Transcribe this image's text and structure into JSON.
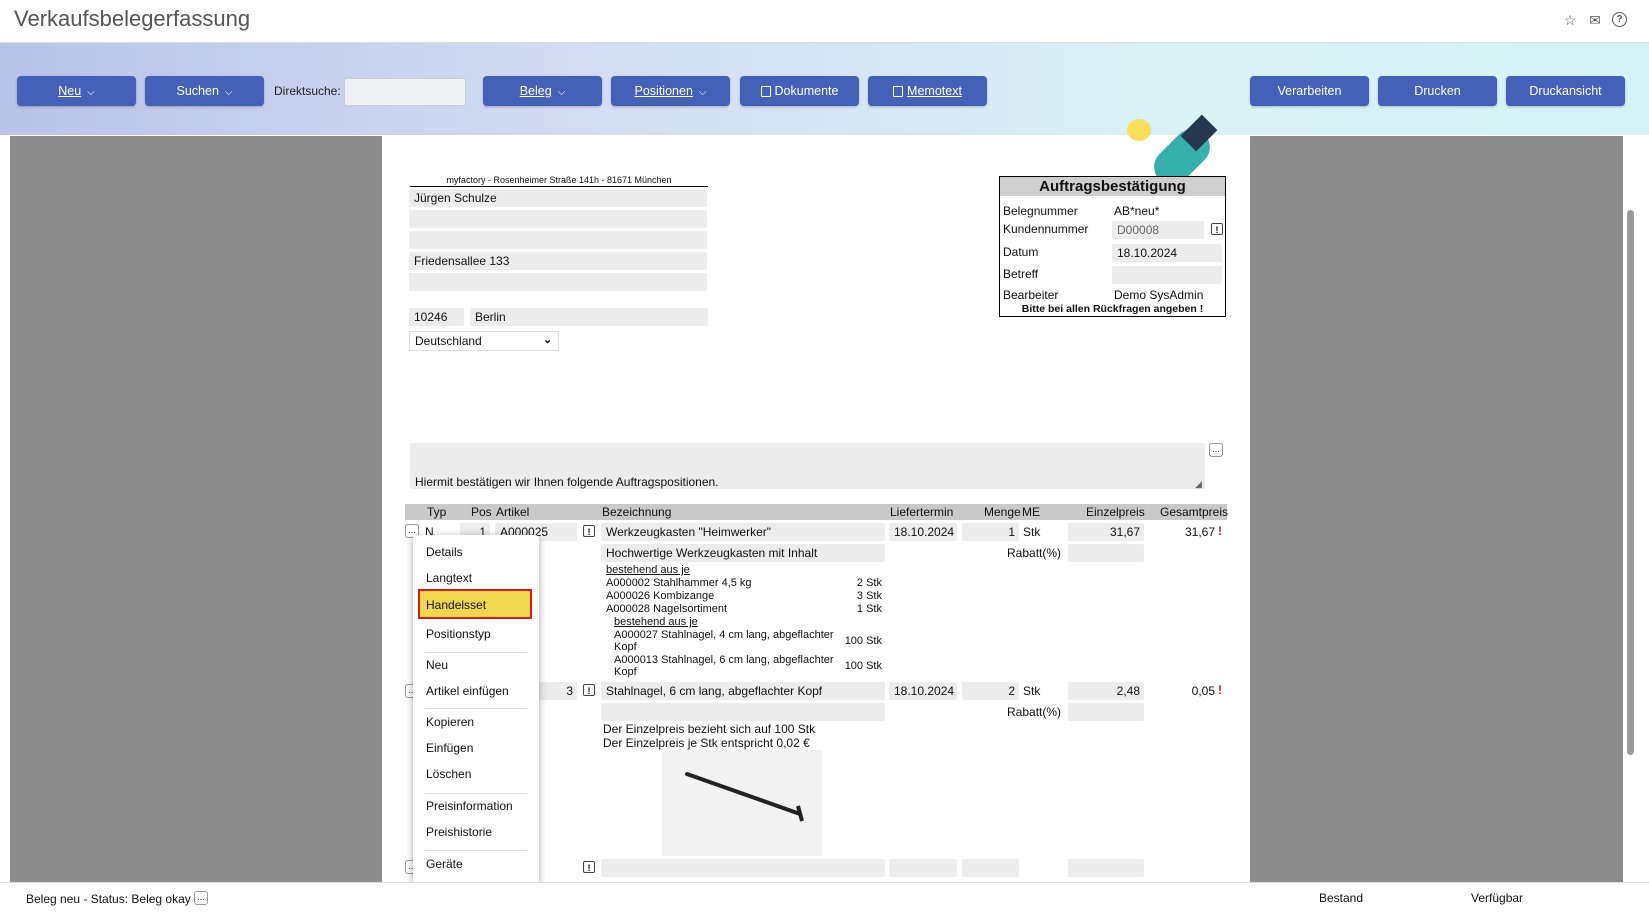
{
  "window": {
    "title": "Verkaufsbelegerfassung"
  },
  "icons": {
    "star": "star-icon",
    "mail": "mail-icon",
    "help": "help-icon"
  },
  "toolbar": {
    "neu": "Neu",
    "suchen": "Suchen",
    "direkt_label": "Direktsuche:",
    "direkt_value": "",
    "beleg": "Beleg",
    "positionen": "Positionen",
    "dokumente": "Dokumente",
    "memotext": "Memotext",
    "verarbeiten": "Verarbeiten",
    "drucken": "Drucken",
    "druckansicht": "Druckansicht"
  },
  "colors": {
    "button": "#4560b7",
    "highlight": "#f0d84e",
    "highlight_border": "#e01818"
  },
  "address": {
    "sender": "myfactory - Rosenheimer Straße 141h - 81671 München",
    "name": "Jürgen Schulze",
    "line2": "",
    "line3": "",
    "street": "Friedensallee 133",
    "line5": "",
    "zip": "10246",
    "city": "Berlin",
    "country": "Deutschland"
  },
  "doc": {
    "heading": "Auftragsbestätigung",
    "belegnummer_label": "Belegnummer",
    "belegnummer": "AB*neu*",
    "kundennummer_label": "Kundennummer",
    "kundennummer": "D00008",
    "datum_label": "Datum",
    "datum": "18.10.2024",
    "betreff_label": "Betreff",
    "betreff": "",
    "bearbeiter_label": "Bearbeiter",
    "bearbeiter": "Demo SysAdmin",
    "note": "Bitte bei allen Rückfragen angeben !"
  },
  "intro_text": "Hiermit bestätigen wir Ihnen folgende Auftragspositionen.",
  "table": {
    "headers": {
      "typ": "Typ",
      "pos": "Pos",
      "artikel": "Artikel",
      "bez": "Bezeichnung",
      "liefer": "Liefertermin",
      "menge": "Menge",
      "me": "ME",
      "einzel": "Einzelpreis",
      "gesamt": "Gesamtpreis"
    },
    "rabatt_label": "Rabatt(%)",
    "row1": {
      "typ": "N",
      "pos": "1",
      "artikel": "A000025",
      "bez": "Werkzeugkasten \"Heimwerker\"",
      "liefer": "18.10.2024",
      "menge": "1",
      "me": "Stk",
      "einzel": "31,67",
      "gesamt": "31,67",
      "desc": "Hochwertige Werkzeugkasten mit Inhalt",
      "set_header": "bestehend aus je",
      "set_items": [
        {
          "text": "A000002 Stahlhammer 4,5 kg",
          "qty": "2 Stk"
        },
        {
          "text": "A000026 Kombizange",
          "qty": "3 Stk"
        },
        {
          "text": "A000028 Nagelsortiment",
          "qty": "1 Stk"
        }
      ],
      "sub_header": "bestehend aus je",
      "sub_items": [
        {
          "line1": "A000027 Stahlnagel, 4 cm lang, abgeflachter",
          "line2": "Kopf",
          "qty": "100 Stk"
        },
        {
          "line1": "A000013 Stahlnagel, 6 cm lang, abgeflachter",
          "line2": "Kopf",
          "qty": "100 Stk"
        }
      ]
    },
    "row2": {
      "artikel_tail": "3",
      "bez": "Stahlnagel, 6 cm lang, abgeflachter Kopf",
      "liefer": "18.10.2024",
      "menge": "2",
      "me": "Stk",
      "einzel": "2,48",
      "gesamt": "0,05",
      "note1": "Der Einzelpreis bezieht sich auf 100 Stk",
      "note2": "Der Einzelpreis je Stk entspricht 0,02 €"
    }
  },
  "context_menu": {
    "details": "Details",
    "langtext": "Langtext",
    "handelsset": "Handelsset",
    "positionstyp": "Positionstyp",
    "neu": "Neu",
    "artikel_einfuegen": "Artikel einfügen",
    "kopieren": "Kopieren",
    "einfuegen": "Einfügen",
    "loeschen": "Löschen",
    "preisinformation": "Preisinformation",
    "preishistorie": "Preishistorie",
    "geraete": "Geräte"
  },
  "status": {
    "text": "Beleg neu - Status: Beleg okay",
    "bestand": "Bestand",
    "verfuegbar": "Verfügbar"
  },
  "symbols": {
    "info": "!",
    "dots": "...",
    "warn": "!"
  }
}
